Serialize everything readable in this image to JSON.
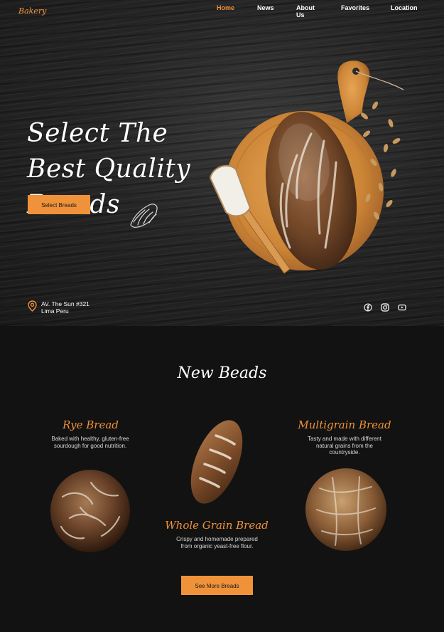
{
  "brand": "Bakery",
  "nav": {
    "items": [
      "Home",
      "News",
      "About Us",
      "Favorites",
      "Location"
    ],
    "active": "Home"
  },
  "hero": {
    "title": "Select The Best Quality Breads",
    "cta_label": "Select Breads"
  },
  "address": {
    "line1": "AV. The Sun #321",
    "line2": "Lima Peru"
  },
  "social": [
    "facebook-icon",
    "instagram-icon",
    "youtube-icon"
  ],
  "section": {
    "title": "New Beads",
    "breads": [
      {
        "name": "Rye Bread",
        "description": "Baked with healthy, gluten-free sourdough for good nutrition."
      },
      {
        "name": "Multigrain Bread",
        "description": "Tasty and made with different natural grains from the countryside."
      },
      {
        "name": "Whole Grain Bread",
        "description": "Crispy and homemade prepared from organic yeast-free flour."
      }
    ],
    "more_label": "See More Breads"
  },
  "colors": {
    "accent": "#f0923a",
    "background": "#121212"
  }
}
